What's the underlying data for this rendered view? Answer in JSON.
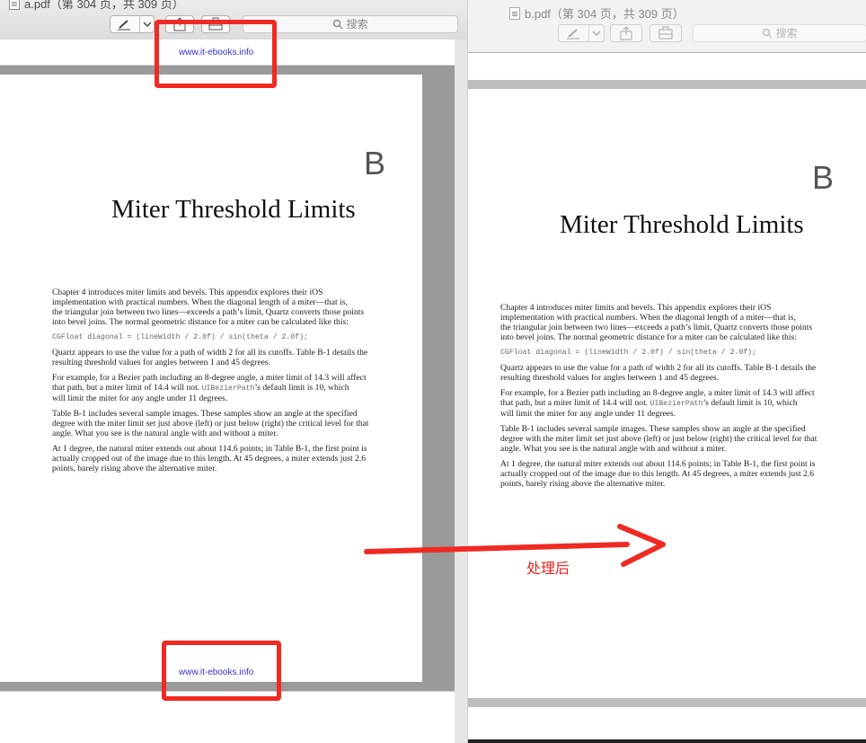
{
  "left_window": {
    "title": "a.pdf（第 304 页，共 309 页）",
    "search_placeholder": "搜索",
    "watermark_top": "www.it-ebooks.info",
    "watermark_bottom": "www.it-ebooks.info",
    "icons": [
      "document-icon",
      "annotate-pen-icon",
      "chevron-down-icon",
      "share-icon",
      "toolbox-icon",
      "search-icon"
    ]
  },
  "right_window": {
    "title": "b.pdf（第 304 页，共 309 页）",
    "search_placeholder": "搜索"
  },
  "page": {
    "chapter_letter": "B",
    "chapter_title": "Miter Threshold Limits",
    "para1_a": "Chapter 4 introduces miter limits and bevels. This appendix explores their iOS",
    "para1_b": "implementation with practical numbers. When the diagonal length of a miter—that is,",
    "para1_c": "the triangular join between two lines—exceeds a path’s limit, Quartz converts those points",
    "para1_d": "into bevel joins. The normal geometric distance for a miter can be calculated like this:",
    "code": "CGFloat diagonal = (lineWidth / 2.0f) / sin(theta / 2.0f);",
    "para2_a": "Quartz appears to use the value for a path of width 2 for all its cutoffs. Table B-1 details the",
    "para2_b": "resulting threshold values for angles between 1 and 45 degrees.",
    "para3_a": "For example, for a Bezier path including an 8-degree angle, a miter limit of 14.3 will affect",
    "para3_b": "that path, but a miter limit of 14.4 will not.",
    "para3_code": "UIBezierPath",
    "para3_c": "’s default limit is 10, which",
    "para3_d": "will limit the miter for any angle under 11 degrees.",
    "para4_a": "Table B-1 includes several sample images. These samples show an angle at the specified",
    "para4_b": "degree with the miter limit set just above (left) or just below (right) the critical level for that",
    "para4_c": "angle. What you see is the natural angle with and without a miter.",
    "para5_a": "At 1 degree, the natural miter extends out about 114.6 points; in Table B-1, the first point is",
    "para5_b": "actually cropped out of the image due to this length. At 45 degrees, a miter extends just 2.6",
    "para5_c": "points, barely rising above the alternative miter."
  },
  "annotation": {
    "label": "处理后",
    "color": "#f02a22"
  }
}
